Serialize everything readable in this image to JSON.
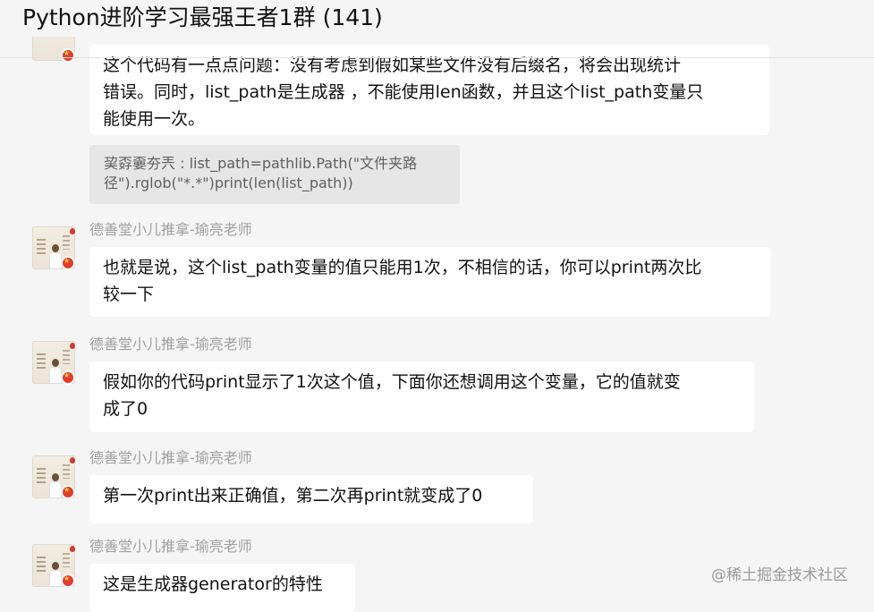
{
  "header": {
    "title": "Python进阶学习最强王者1群",
    "member_count": "(141)"
  },
  "messages": [
    {
      "type": "bubble",
      "text_line1": "这个代码有一点点问题：没有考虑到假如某些文件没有后缀名，将会出现统计",
      "text_line2": "错误。同时，list_path是生成器 ，不能使用len函数，并且这个list_path变量只",
      "text_line3": "能使用一次。"
    },
    {
      "type": "quote",
      "text_line1": "巭孬嫑夯兲 : list_path=pathlib.Path(\"文件夹路",
      "text_line2": "径\").rglob(\"*.*\")print(len(list_path))"
    },
    {
      "type": "bubble",
      "sender": "德善堂小儿推拿-瑜亮老师",
      "text_line1": "也就是说，这个list_path变量的值只能用1次，不相信的话，你可以print两次比",
      "text_line2": "较一下"
    },
    {
      "type": "bubble",
      "sender": "德善堂小儿推拿-瑜亮老师",
      "text_line1": "假如你的代码print显示了1次这个值，下面你还想调用这个变量，它的值就变",
      "text_line2": "成了0"
    },
    {
      "type": "bubble",
      "sender": "德善堂小儿推拿-瑜亮老师",
      "text_line1": "第一次print出来正确值，第二次再print就变成了0"
    },
    {
      "type": "bubble",
      "sender": "德善堂小儿推拿-瑜亮老师",
      "text_line1": "这是生成器generator的特性"
    }
  ],
  "watermark": "@稀土掘金技术社区"
}
